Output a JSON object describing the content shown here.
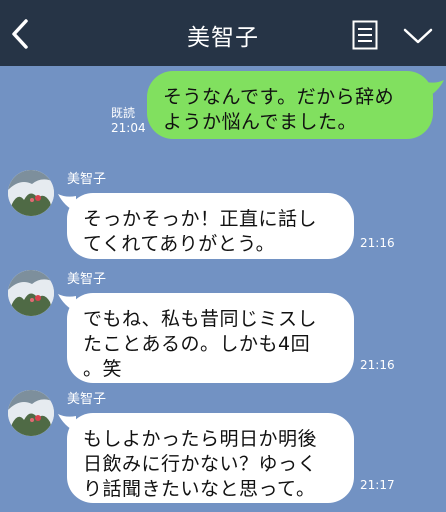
{
  "header": {
    "title": "美智子",
    "back_icon": "chevron-left-icon",
    "menu_icon": "list-icon",
    "collapse_icon": "chevron-down-icon",
    "bg_color": "#263446"
  },
  "colors": {
    "chat_background": "#7292c3",
    "sent_bubble": "#81e05f",
    "received_bubble": "#ffffff"
  },
  "messages": [
    {
      "direction": "sent",
      "lines": [
        "そうなんです。だから辞め",
        "ようか悩んでました。"
      ],
      "read_label": "既読",
      "time": "21:04"
    },
    {
      "direction": "received",
      "sender": "美智子",
      "lines": [
        "そっかそっか！正直に話し",
        "てくれてありがとう。"
      ],
      "time": "21:16"
    },
    {
      "direction": "received",
      "sender": "美智子",
      "lines": [
        "でもね、私も昔同じミスし",
        "たことあるの。しかも4回",
        "。笑"
      ],
      "time": "21:16"
    },
    {
      "direction": "received",
      "sender": "美智子",
      "lines": [
        "もしよかったら明日か明後",
        "日飲みに行かない？ゆっく",
        "り話聞きたいなと思って。"
      ],
      "time": "21:17"
    }
  ]
}
